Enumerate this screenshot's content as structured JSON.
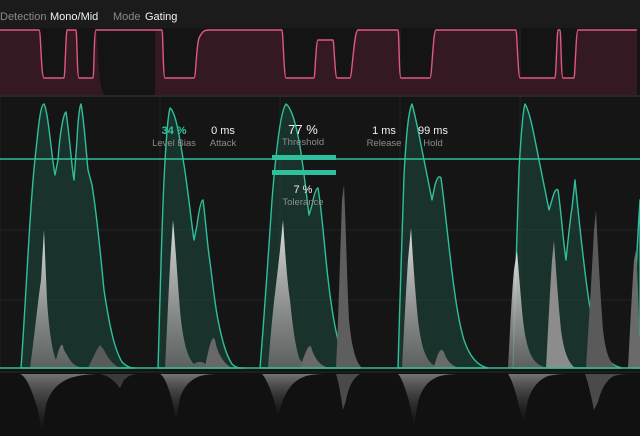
{
  "toolbar": {
    "detection_label": "Detection",
    "detection_value": "Mono/Mid",
    "mode_label": "Mode",
    "mode_value": "Gating"
  },
  "params": {
    "level_bias": {
      "value": "34 %",
      "label": "Level Bias"
    },
    "attack": {
      "value": "0 ms",
      "label": "Attack"
    },
    "threshold": {
      "value": "77 %",
      "label": "Threshold"
    },
    "release": {
      "value": "1 ms",
      "label": "Release"
    },
    "hold": {
      "value": "99 ms",
      "label": "Hold"
    },
    "tolerance": {
      "value": "7 %",
      "label": "Tolerance"
    }
  },
  "colors": {
    "accent": "#2fbf9c",
    "gate": "#e0587e",
    "background": "#161616"
  }
}
